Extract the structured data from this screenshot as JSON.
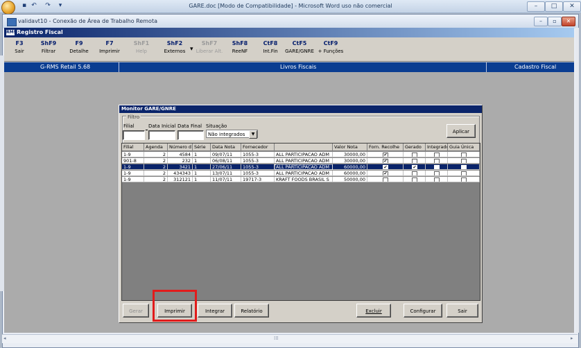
{
  "word": {
    "title": "GARE.doc [Modo de Compatibilidade] - Microsoft Word uso não comercial"
  },
  "remote": {
    "title": "validavt10 - Conexão de Área de Trabalho Remota"
  },
  "app": {
    "title": "Registro Fiscal",
    "logo": "RMS",
    "fkeys": [
      {
        "key": "F3",
        "label": "Sair",
        "enabled": true
      },
      {
        "key": "ShF9",
        "label": "Filtrar",
        "enabled": true
      },
      {
        "key": "F9",
        "label": "Detalhe",
        "enabled": true
      },
      {
        "key": "F7",
        "label": "Imprimir",
        "enabled": true
      },
      {
        "key": "ShF1",
        "label": "Help",
        "enabled": false
      },
      {
        "key": "ShF2",
        "label": "Externos",
        "enabled": true
      },
      {
        "key": "ShF7",
        "label": "Liberar Alt.",
        "enabled": false
      },
      {
        "key": "ShF8",
        "label": "ReeNF",
        "enabled": true
      },
      {
        "key": "CtF8",
        "label": "Int.Fin",
        "enabled": true
      },
      {
        "key": "CtF5",
        "label": "GARE/GNRE",
        "enabled": true
      },
      {
        "key": "CtF9",
        "label": "+ Funções",
        "enabled": true
      }
    ],
    "band": {
      "left": "G-RMS Retail 5.68",
      "center": "Livros Fiscais",
      "right": "Cadastro Fiscal"
    }
  },
  "dialog": {
    "title": "Monitor GARE/GNRE",
    "filter": {
      "legend": "Filtro",
      "filial_label": "Filial",
      "data_inicial_label": "Data Inicial",
      "data_final_label": "Data Final",
      "situacao_label": "Situação",
      "situacao_value": "Não integrados",
      "apply_button": "Aplicar"
    },
    "columns": [
      "Filial",
      "Agenda",
      "Número d",
      "Série",
      "Data Nota",
      "Fornecedor",
      "",
      "Valor Nota",
      "Forn. Recolhe",
      "Gerado",
      "Integrado",
      "Guia Única"
    ],
    "rows": [
      {
        "filial": "1-9",
        "agenda": "2",
        "numero": "4584",
        "serie": "1",
        "data": "09/07/11",
        "forn_cod": "1055-3",
        "forn_nome": "ALL PARTICIPACAO ADM",
        "valor": "30000,00",
        "recolhe": true,
        "gerado": false,
        "integrado": false,
        "guia": false,
        "selected": false
      },
      {
        "filial": "901-8",
        "agenda": "2",
        "numero": "232",
        "serie": "1",
        "data": "06/08/11",
        "forn_cod": "1055-3",
        "forn_nome": "ALL PARTICIPACAO ADM",
        "valor": "30000,00",
        "recolhe": true,
        "gerado": false,
        "integrado": false,
        "guia": false,
        "selected": false
      },
      {
        "filial": "1-9",
        "agenda": "2",
        "numero": "3421",
        "serie": "1",
        "data": "27/06/11",
        "forn_cod": "1055-3",
        "forn_nome": "ALL PARTICIPACAO ADM",
        "valor": "60000,00",
        "recolhe": true,
        "gerado": true,
        "integrado": false,
        "guia": false,
        "selected": true
      },
      {
        "filial": "1-9",
        "agenda": "2",
        "numero": "434343",
        "serie": "1",
        "data": "13/07/11",
        "forn_cod": "1055-3",
        "forn_nome": "ALL PARTICIPACAO ADM",
        "valor": "60000,00",
        "recolhe": true,
        "gerado": false,
        "integrado": false,
        "guia": false,
        "selected": false
      },
      {
        "filial": "1-9",
        "agenda": "2",
        "numero": "312121",
        "serie": "1",
        "data": "11/07/11",
        "forn_cod": "19717-3",
        "forn_nome": "KRAFT FOODS BRASIL S",
        "valor": "50000,00",
        "recolhe": false,
        "gerado": false,
        "integrado": false,
        "guia": false,
        "selected": false
      }
    ],
    "buttons": {
      "gerar": "Gerar",
      "imprimir": "Imprimir",
      "integrar": "Integrar",
      "relatorio": "Relatório",
      "excluir": "Excluir",
      "configurar": "Configurar",
      "sair": "Sair"
    }
  },
  "colors": {
    "band": "#0a3d91",
    "selection": "#0a246a",
    "highlight": "#e21b1b"
  }
}
